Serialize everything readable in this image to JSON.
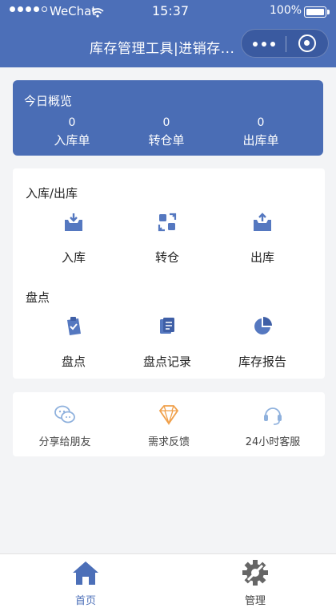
{
  "status_bar": {
    "carrier": "WeChat",
    "time": "15:37",
    "battery": "100%",
    "battery_level": 1.0
  },
  "nav": {
    "title": "库存管理工具|进销存..."
  },
  "overview": {
    "title": "今日概览",
    "stats": [
      {
        "value": "0",
        "label": "入库单"
      },
      {
        "value": "0",
        "label": "转仓单"
      },
      {
        "value": "0",
        "label": "出库单"
      }
    ]
  },
  "inout_section": {
    "title": "入库/出库",
    "items": [
      {
        "label": "入库",
        "icon": "inbox-in-icon"
      },
      {
        "label": "转仓",
        "icon": "transfer-icon"
      },
      {
        "label": "出库",
        "icon": "inbox-out-icon"
      }
    ]
  },
  "inventory_section": {
    "title": "盘点",
    "items": [
      {
        "label": "盘点",
        "icon": "clipboard-check-icon"
      },
      {
        "label": "盘点记录",
        "icon": "records-icon"
      },
      {
        "label": "库存报告",
        "icon": "pie-chart-icon"
      }
    ]
  },
  "tools": [
    {
      "label": "分享给朋友",
      "icon": "wechat-share-icon"
    },
    {
      "label": "需求反馈",
      "icon": "diamond-feedback-icon"
    },
    {
      "label": "24小时客服",
      "icon": "headset-icon"
    }
  ],
  "tabbar": [
    {
      "label": "首页",
      "icon": "home-icon",
      "active": true
    },
    {
      "label": "管理",
      "icon": "gear-tools-icon",
      "active": false
    }
  ],
  "colors": {
    "primary": "#4c6fb8",
    "icon_blue": "#5578c0",
    "feedback_orange": "#f0a04b",
    "light_blue": "#8fb1dd"
  }
}
